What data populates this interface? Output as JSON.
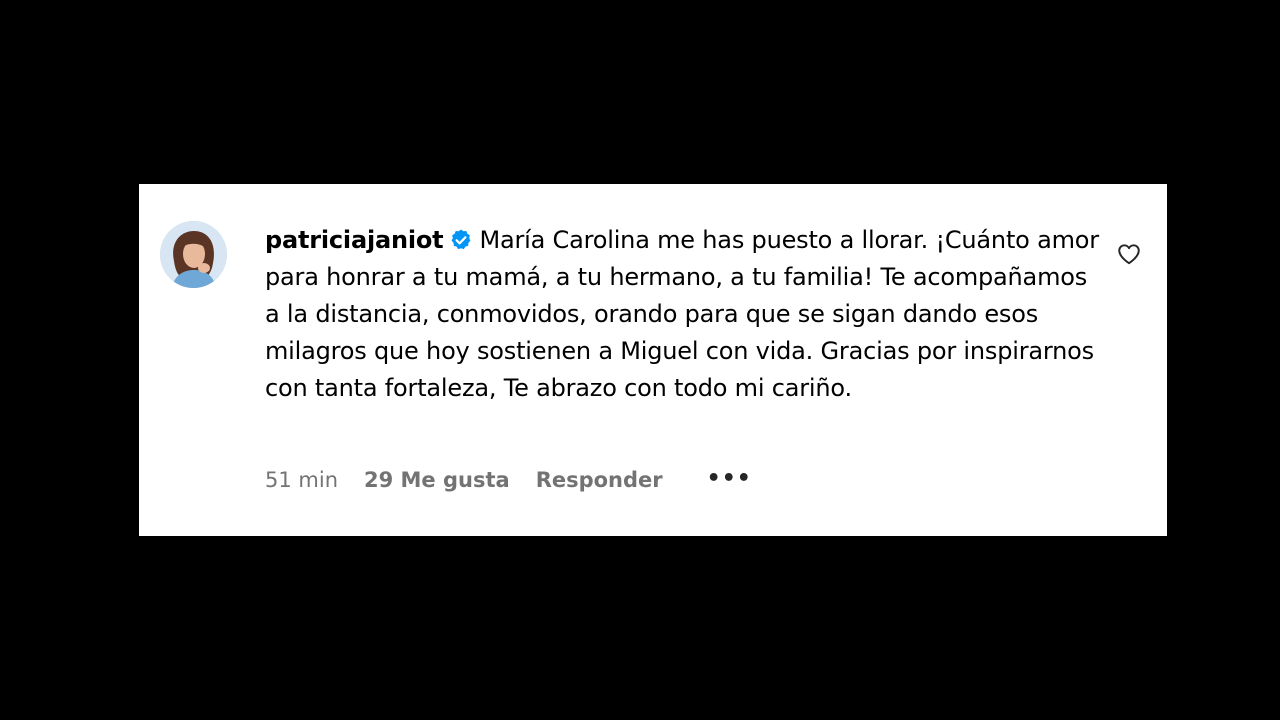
{
  "comment": {
    "username": "patriciajaniot",
    "verified_icon": "verified-badge-icon",
    "text": "María Carolina me has puesto a llorar. ¡Cuánto amor para honrar a tu mamá, a tu hermano, a tu familia! Te acompañamos a la distancia, conmovidos, orando para que se sigan dando esos milagros que hoy sostienen a Miguel con vida. Gracias por inspirarnos con tanta fortaleza, Te abrazo con todo mi cariño.",
    "time": "51 min",
    "likes": "29 Me gusta",
    "reply_label": "Responder",
    "more_label": "•••",
    "like_icon": "heart-outline-icon"
  },
  "colors": {
    "background": "#000000",
    "card": "#ffffff",
    "verified": "#0095f6",
    "meta_text": "#737373"
  }
}
